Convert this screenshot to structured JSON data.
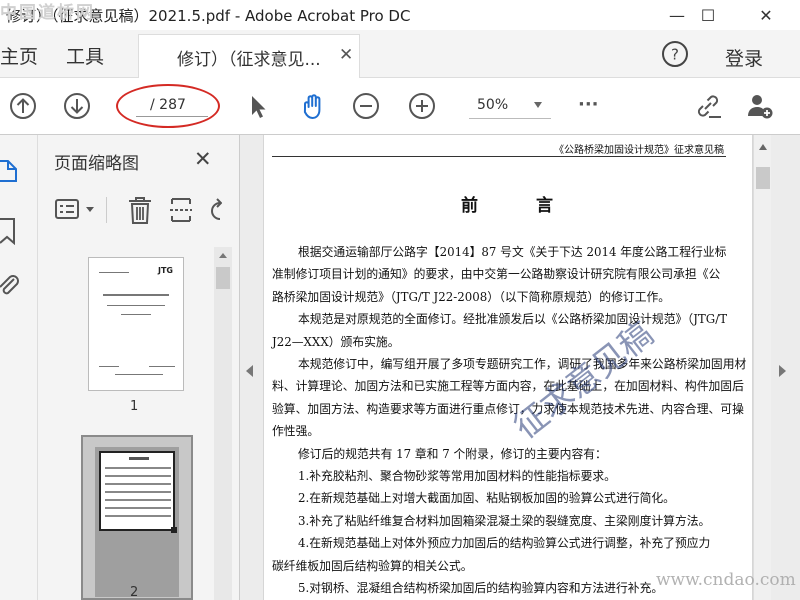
{
  "window": {
    "title": "修订）（征求意见稿）2021.5.pdf - Adobe Acrobat Pro DC",
    "corner_watermark": "中国道桥网",
    "minimize": "—",
    "maximize": "☐",
    "close": "✕"
  },
  "tabs": {
    "home": "主页",
    "tools": "工具",
    "document": "修订）（征求意见...",
    "document_close": "✕",
    "help": "?",
    "login": "登录"
  },
  "toolbar": {
    "page_count": "/ 287",
    "zoom": "50%",
    "more": "···",
    "annotation_color": "#d42a24"
  },
  "thumbnail_panel": {
    "title": "页面缩略图",
    "close": "✕",
    "thumbnails": [
      {
        "label": "1",
        "cover_tag": "JTG"
      },
      {
        "label": "2"
      }
    ]
  },
  "document": {
    "header": "《公路桥梁加固设计规范》征求意见稿",
    "title": "前 言",
    "lines": [
      {
        "indent": true,
        "text": "根据交通运输部厅公路字【2014】87 号文《关于下达 2014 年度公路工程行业标"
      },
      {
        "indent": false,
        "text": "准制修订项目计划的通知》的要求，由中交第一公路勘察设计研究院有限公司承担《公"
      },
      {
        "indent": false,
        "text": "路桥梁加固设计规范》（JTG/T J22-2008）（以下简称原规范）的修订工作。"
      },
      {
        "indent": true,
        "text": "本规范是对原规范的全面修订。经批准颁发后以《公路桥梁加固设计规范》（JTG/T"
      },
      {
        "indent": false,
        "text": "J22—XXX）颁布实施。"
      },
      {
        "indent": true,
        "text": "本规范修订中，编写组开展了多项专题研究工作，调研了我国多年来公路桥梁加固用材"
      },
      {
        "indent": false,
        "text": "料、计算理论、加固方法和已实施工程等方面内容，在此基础上，在加固材料、构件加固后"
      },
      {
        "indent": false,
        "text": "验算、加固方法、构造要求等方面进行重点修订，力求使本规范技术先进、内容合理、可操"
      },
      {
        "indent": false,
        "text": "作性强。"
      },
      {
        "indent": true,
        "text": "修订后的规范共有 17 章和 7 个附录，修订的主要内容有："
      },
      {
        "indent": true,
        "text": "1.补充胶粘剂、聚合物砂浆等常用加固材料的性能指标要求。"
      },
      {
        "indent": true,
        "text": "2.在新规范基础上对增大截面加固、粘贴钢板加固的验算公式进行简化。"
      },
      {
        "indent": true,
        "text": "3.补充了粘贴纤维复合材料加固箱梁混凝土梁的裂缝宽度、主梁刚度计算方法。"
      },
      {
        "indent": true,
        "text": "4.在新规范基础上对体外预应力加固后的结构验算公式进行调整，补充了预应力"
      },
      {
        "indent": false,
        "text": "碳纤维板加固后结构验算的相关公式。"
      },
      {
        "indent": true,
        "text": "5.对钢桥、混凝组合结构桥梁加固后的结构验算内容和方法进行补充。"
      }
    ],
    "stamp_watermark": "征求意见稿",
    "site_watermark": "www.cndao.com"
  }
}
